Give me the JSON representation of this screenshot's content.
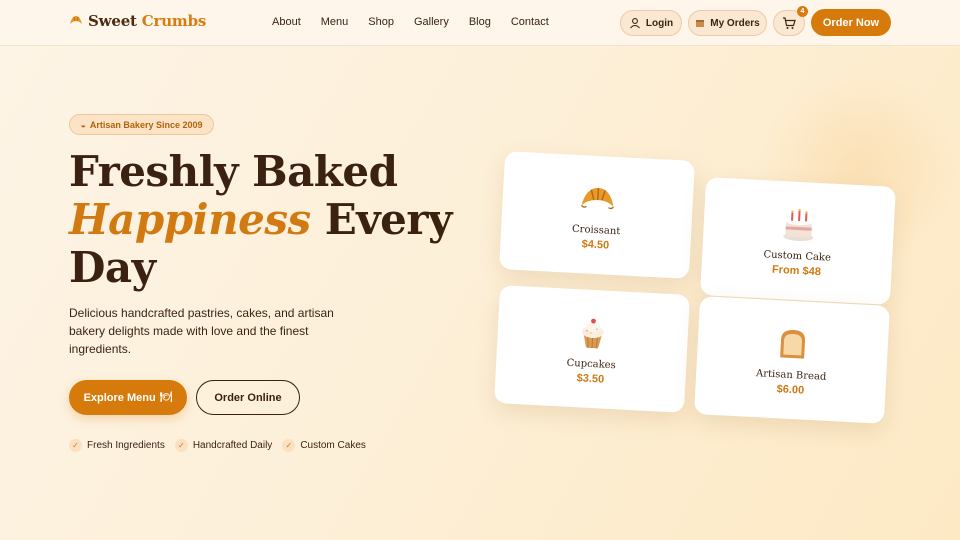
{
  "brand": {
    "name_part1": "Sweet",
    "name_part2": "Crumbs"
  },
  "nav": {
    "links": [
      "About",
      "Menu",
      "Shop",
      "Gallery",
      "Blog",
      "Contact"
    ],
    "login_label": "Login",
    "orders_label": "My Orders",
    "cart_count": "4",
    "order_now_label": "Order Now"
  },
  "hero": {
    "badge": "Artisan Bakery Since 2009",
    "title_line1": "Freshly Baked",
    "title_accent": "Happiness",
    "title_rest": "Every",
    "title_line3": "Day",
    "description": "Delicious handcrafted pastries, cakes, and artisan bakery delights made with love and the finest ingredients.",
    "explore_label": "Explore Menu",
    "online_label": "Order Online",
    "features": [
      "Fresh Ingredients",
      "Handcrafted Daily",
      "Custom Cakes"
    ]
  },
  "products": [
    {
      "name": "Croissant",
      "price": "$4.50",
      "icon": "croissant-icon"
    },
    {
      "name": "Custom Cake",
      "price": "From $48",
      "icon": "cake-icon"
    },
    {
      "name": "Cupcakes",
      "price": "$3.50",
      "icon": "cupcake-icon"
    },
    {
      "name": "Artisan Bread",
      "price": "$6.00",
      "icon": "bread-icon"
    }
  ],
  "colors": {
    "accent": "#d67a0c",
    "dark": "#3b2210",
    "background": "#fdf2e0"
  }
}
